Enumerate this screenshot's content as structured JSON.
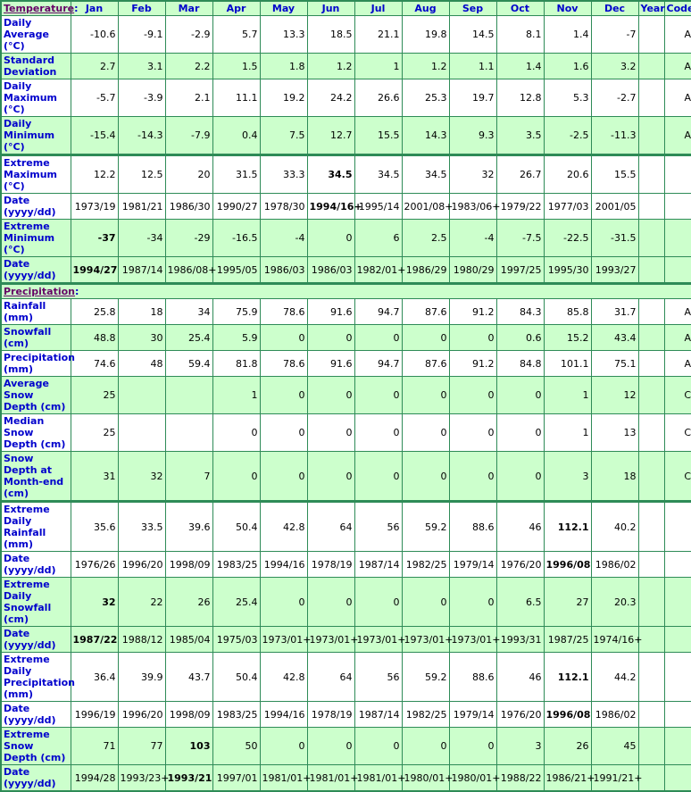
{
  "header": {
    "temperature_label": "Temperature",
    "precipitation_label": "Precipitation",
    "colon": ":",
    "months": [
      "Jan",
      "Feb",
      "Mar",
      "Apr",
      "May",
      "Jun",
      "Jul",
      "Aug",
      "Sep",
      "Oct",
      "Nov",
      "Dec"
    ],
    "year": "Year",
    "code": "Code"
  },
  "temperature": [
    {
      "label": "Daily Average (°C)",
      "values": [
        "-10.6",
        "-9.1",
        "-2.9",
        "5.7",
        "13.3",
        "18.5",
        "21.1",
        "19.8",
        "14.5",
        "8.1",
        "1.4",
        "-7"
      ],
      "bold": [],
      "year": "",
      "code": "A",
      "bg": "w"
    },
    {
      "label": "Standard Deviation",
      "values": [
        "2.7",
        "3.1",
        "2.2",
        "1.5",
        "1.8",
        "1.2",
        "1",
        "1.2",
        "1.1",
        "1.4",
        "1.6",
        "3.2"
      ],
      "bold": [],
      "year": "",
      "code": "A",
      "bg": "g"
    },
    {
      "label": "Daily Maximum (°C)",
      "values": [
        "-5.7",
        "-3.9",
        "2.1",
        "11.1",
        "19.2",
        "24.2",
        "26.6",
        "25.3",
        "19.7",
        "12.8",
        "5.3",
        "-2.7"
      ],
      "bold": [],
      "year": "",
      "code": "A",
      "bg": "w"
    },
    {
      "label": "Daily Minimum (°C)",
      "values": [
        "-15.4",
        "-14.3",
        "-7.9",
        "0.4",
        "7.5",
        "12.7",
        "15.5",
        "14.3",
        "9.3",
        "3.5",
        "-2.5",
        "-11.3"
      ],
      "bold": [],
      "year": "",
      "code": "A",
      "bg": "g"
    },
    {
      "label": "Extreme Maximum (°C)",
      "values": [
        "12.2",
        "12.5",
        "20",
        "31.5",
        "33.3",
        "34.5",
        "34.5",
        "34.5",
        "32",
        "26.7",
        "20.6",
        "15.5"
      ],
      "bold": [
        5
      ],
      "year": "",
      "code": "",
      "bg": "w",
      "secttop": true
    },
    {
      "label": "Date (yyyy/dd)",
      "values": [
        "1973/19",
        "1981/21",
        "1986/30",
        "1990/27",
        "1978/30",
        "1994/16+",
        "1995/14",
        "2001/08+",
        "1983/06+",
        "1979/22",
        "1977/03",
        "2001/05"
      ],
      "bold": [
        5
      ],
      "year": "",
      "code": "",
      "bg": "w"
    },
    {
      "label": "Extreme Minimum (°C)",
      "values": [
        "-37",
        "-34",
        "-29",
        "-16.5",
        "-4",
        "0",
        "6",
        "2.5",
        "-4",
        "-7.5",
        "-22.5",
        "-31.5"
      ],
      "bold": [
        0
      ],
      "year": "",
      "code": "",
      "bg": "g"
    },
    {
      "label": "Date (yyyy/dd)",
      "values": [
        "1994/27",
        "1987/14",
        "1986/08+",
        "1995/05",
        "1986/03",
        "1986/03",
        "1982/01+",
        "1986/29",
        "1980/29",
        "1997/25",
        "1995/30",
        "1993/27"
      ],
      "bold": [
        0
      ],
      "year": "",
      "code": "",
      "bg": "g"
    }
  ],
  "precipitation": [
    {
      "label": "Rainfall (mm)",
      "values": [
        "25.8",
        "18",
        "34",
        "75.9",
        "78.6",
        "91.6",
        "94.7",
        "87.6",
        "91.2",
        "84.3",
        "85.8",
        "31.7"
      ],
      "bold": [],
      "year": "",
      "code": "A",
      "bg": "w"
    },
    {
      "label": "Snowfall (cm)",
      "values": [
        "48.8",
        "30",
        "25.4",
        "5.9",
        "0",
        "0",
        "0",
        "0",
        "0",
        "0.6",
        "15.2",
        "43.4"
      ],
      "bold": [],
      "year": "",
      "code": "A",
      "bg": "g"
    },
    {
      "label": "Precipitation (mm)",
      "values": [
        "74.6",
        "48",
        "59.4",
        "81.8",
        "78.6",
        "91.6",
        "94.7",
        "87.6",
        "91.2",
        "84.8",
        "101.1",
        "75.1"
      ],
      "bold": [],
      "year": "",
      "code": "A",
      "bg": "w"
    },
    {
      "label": "Average Snow Depth (cm)",
      "values": [
        "25",
        "",
        "",
        "1",
        "0",
        "0",
        "0",
        "0",
        "0",
        "0",
        "1",
        "12"
      ],
      "bold": [],
      "year": "",
      "code": "C",
      "bg": "g"
    },
    {
      "label": "Median Snow Depth (cm)",
      "values": [
        "25",
        "",
        "",
        "0",
        "0",
        "0",
        "0",
        "0",
        "0",
        "0",
        "1",
        "13"
      ],
      "bold": [],
      "year": "",
      "code": "C",
      "bg": "w"
    },
    {
      "label": "Snow Depth at Month-end (cm)",
      "values": [
        "31",
        "32",
        "7",
        "0",
        "0",
        "0",
        "0",
        "0",
        "0",
        "0",
        "3",
        "18"
      ],
      "bold": [],
      "year": "",
      "code": "C",
      "bg": "g"
    },
    {
      "label": "Extreme Daily Rainfall (mm)",
      "values": [
        "35.6",
        "33.5",
        "39.6",
        "50.4",
        "42.8",
        "64",
        "56",
        "59.2",
        "88.6",
        "46",
        "112.1",
        "40.2"
      ],
      "bold": [
        10
      ],
      "year": "",
      "code": "",
      "bg": "w",
      "secttop": true
    },
    {
      "label": "Date (yyyy/dd)",
      "values": [
        "1976/26",
        "1996/20",
        "1998/09",
        "1983/25",
        "1994/16",
        "1978/19",
        "1987/14",
        "1982/25",
        "1979/14",
        "1976/20",
        "1996/08",
        "1986/02"
      ],
      "bold": [
        10
      ],
      "year": "",
      "code": "",
      "bg": "w"
    },
    {
      "label": "Extreme Daily Snowfall (cm)",
      "values": [
        "32",
        "22",
        "26",
        "25.4",
        "0",
        "0",
        "0",
        "0",
        "0",
        "6.5",
        "27",
        "20.3"
      ],
      "bold": [
        0
      ],
      "year": "",
      "code": "",
      "bg": "g"
    },
    {
      "label": "Date (yyyy/dd)",
      "values": [
        "1987/22",
        "1988/12",
        "1985/04",
        "1975/03",
        "1973/01+",
        "1973/01+",
        "1973/01+",
        "1973/01+",
        "1973/01+",
        "1993/31",
        "1987/25",
        "1974/16+"
      ],
      "bold": [
        0
      ],
      "year": "",
      "code": "",
      "bg": "g"
    },
    {
      "label": "Extreme Daily Precipitation (mm)",
      "values": [
        "36.4",
        "39.9",
        "43.7",
        "50.4",
        "42.8",
        "64",
        "56",
        "59.2",
        "88.6",
        "46",
        "112.1",
        "44.2"
      ],
      "bold": [
        10
      ],
      "year": "",
      "code": "",
      "bg": "w"
    },
    {
      "label": "Date (yyyy/dd)",
      "values": [
        "1996/19",
        "1996/20",
        "1998/09",
        "1983/25",
        "1994/16",
        "1978/19",
        "1987/14",
        "1982/25",
        "1979/14",
        "1976/20",
        "1996/08",
        "1986/02"
      ],
      "bold": [
        10
      ],
      "year": "",
      "code": "",
      "bg": "w"
    },
    {
      "label": "Extreme Snow Depth (cm)",
      "values": [
        "71",
        "77",
        "103",
        "50",
        "0",
        "0",
        "0",
        "0",
        "0",
        "3",
        "26",
        "45"
      ],
      "bold": [
        2
      ],
      "year": "",
      "code": "",
      "bg": "g"
    },
    {
      "label": "Date (yyyy/dd)",
      "values": [
        "1994/28",
        "1993/23+",
        "1993/21",
        "1997/01",
        "1981/01+",
        "1981/01+",
        "1981/01+",
        "1980/01+",
        "1980/01+",
        "1988/22",
        "1986/21+",
        "1991/21+"
      ],
      "bold": [
        2
      ],
      "year": "",
      "code": "",
      "bg": "g"
    }
  ]
}
